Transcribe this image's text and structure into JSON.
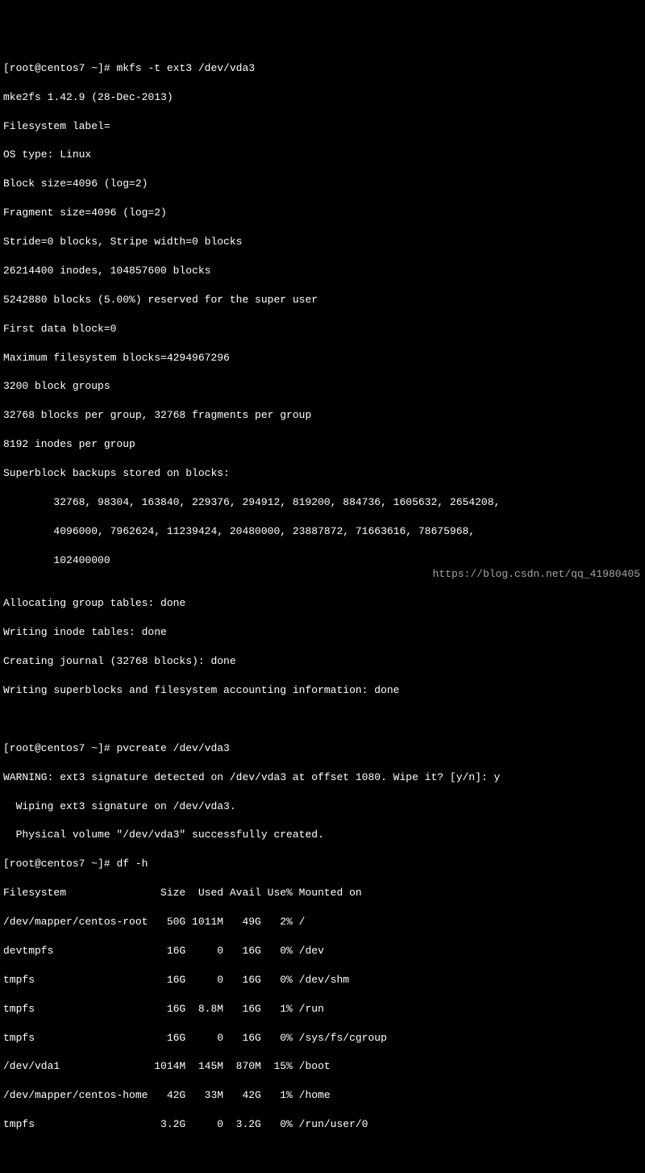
{
  "prompt1": "[root@centos7 ~]# ",
  "cmd1": "mkfs -t ext3 /dev/vda3",
  "mkfs": {
    "l1": "mke2fs 1.42.9 (28-Dec-2013)",
    "l2": "Filesystem label=",
    "l3": "OS type: Linux",
    "l4": "Block size=4096 (log=2)",
    "l5": "Fragment size=4096 (log=2)",
    "l6": "Stride=0 blocks, Stripe width=0 blocks",
    "l7": "26214400 inodes, 104857600 blocks",
    "l8": "5242880 blocks (5.00%) reserved for the super user",
    "l9": "First data block=0",
    "l10": "Maximum filesystem blocks=4294967296",
    "l11": "3200 block groups",
    "l12": "32768 blocks per group, 32768 fragments per group",
    "l13": "8192 inodes per group",
    "l14": "Superblock backups stored on blocks:",
    "l15": "        32768, 98304, 163840, 229376, 294912, 819200, 884736, 1605632, 2654208,",
    "l16": "        4096000, 7962624, 11239424, 20480000, 23887872, 71663616, 78675968,",
    "l17": "        102400000",
    "l18": "",
    "l19": "Allocating group tables: done",
    "l20": "Writing inode tables: done",
    "l21": "Creating journal (32768 blocks): done",
    "l22": "Writing superblocks and filesystem accounting information: done"
  },
  "prompt2": "[root@centos7 ~]# ",
  "cmd2": "pvcreate /dev/vda3",
  "pv": {
    "l1": "WARNING: ext3 signature detected on /dev/vda3 at offset 1080. Wipe it? [y/n]: y",
    "l2": "  Wiping ext3 signature on /dev/vda3.",
    "l3": "  Physical volume \"/dev/vda3\" successfully created."
  },
  "prompt3": "[root@centos7 ~]# ",
  "cmd3": "df -h",
  "df": {
    "h": "Filesystem               Size  Used Avail Use% Mounted on",
    "r1": "/dev/mapper/centos-root   50G 1011M   49G   2% /",
    "r2": "devtmpfs                  16G     0   16G   0% /dev",
    "r3": "tmpfs                     16G     0   16G   0% /dev/shm",
    "r4": "tmpfs                     16G  8.8M   16G   1% /run",
    "r5": "tmpfs                     16G     0   16G   0% /sys/fs/cgroup",
    "r6": "/dev/vda1               1014M  145M  870M  15% /boot",
    "r7": "/dev/mapper/centos-home   42G   33M   42G   1% /home",
    "r8": "tmpfs                    3.2G     0  3.2G   0% /run/user/0"
  },
  "watermark": "https://blog.csdn.net/qq_41980405"
}
